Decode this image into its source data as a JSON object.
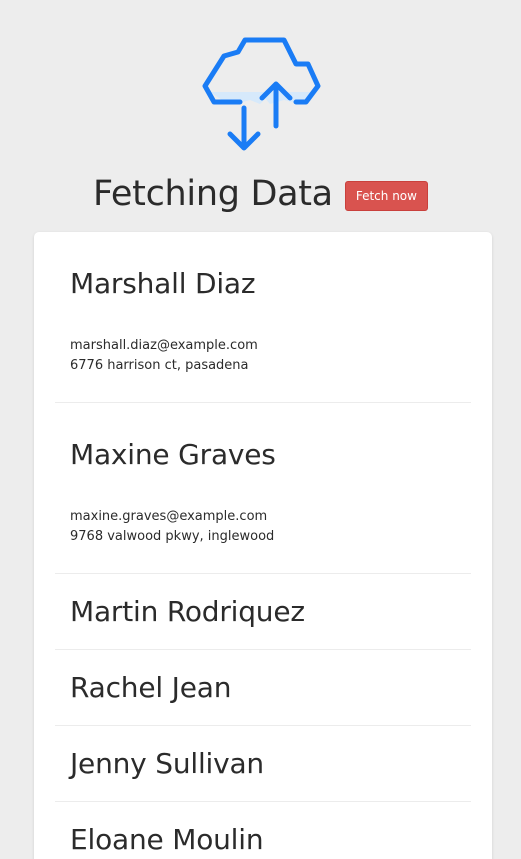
{
  "header": {
    "title": "Fetching Data",
    "fetch_button_label": "Fetch now"
  },
  "logo": {
    "icon": "cloud-upload-download-icon",
    "color": "#1a7cf5",
    "fill": "#d6e9fb"
  },
  "people": [
    {
      "name": "Marshall Diaz",
      "expanded": true,
      "email": "marshall.diaz@example.com",
      "address": "6776 harrison ct, pasadena"
    },
    {
      "name": "Maxine Graves",
      "expanded": true,
      "email": "maxine.graves@example.com",
      "address": "9768 valwood pkwy, inglewood"
    },
    {
      "name": "Martin Rodriquez",
      "expanded": false
    },
    {
      "name": "Rachel Jean",
      "expanded": false
    },
    {
      "name": "Jenny Sullivan",
      "expanded": false
    },
    {
      "name": "Eloane Moulin",
      "expanded": false
    }
  ],
  "colors": {
    "background": "#ededed",
    "button": "#d9534f",
    "card": "#ffffff"
  }
}
